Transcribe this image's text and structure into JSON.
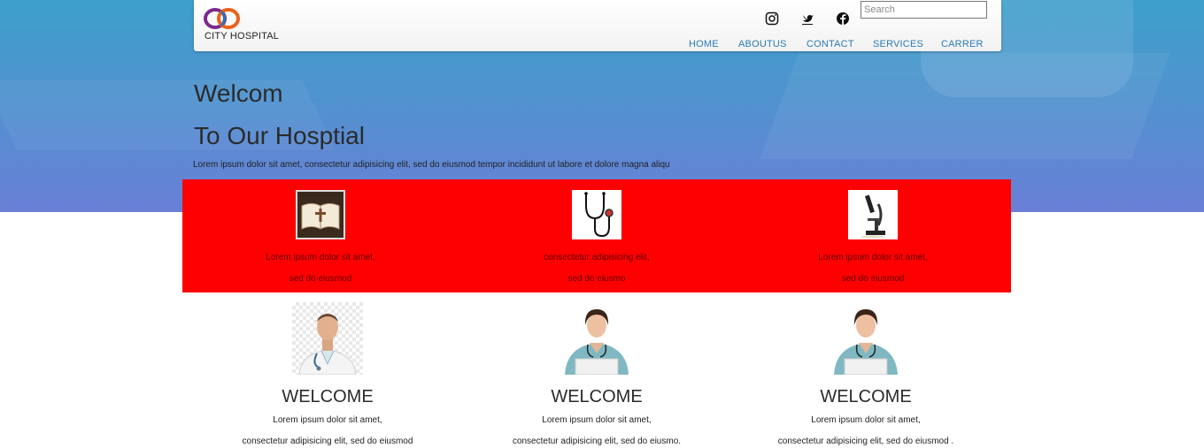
{
  "header": {
    "brand": "CITY HOSPITAL",
    "search": {
      "placeholder": "Search",
      "value": ""
    },
    "social": [
      "instagram-icon",
      "twitter-icon",
      "facebook-icon"
    ],
    "nav": [
      "HOME",
      "ABOUTUS",
      "CONTACT",
      "SERVICES",
      "CARRER"
    ]
  },
  "hero": {
    "title_line1": "Welcom",
    "title_line2": "To Our Hosptial",
    "intro": "Lorem ipsum dolor sit amet, consectetur adipisicing elit, sed do eiusmod tempor incididunt ut labore et dolore magna aliqu"
  },
  "features": [
    {
      "icon": "bible-image",
      "line1": "Lorem ipsum dolor sit amet,",
      "line2": "sed do eiusmod"
    },
    {
      "icon": "stethoscope-image",
      "line1": "consectetur adipisicing elit,",
      "line2": "sed do eiusmo"
    },
    {
      "icon": "microscope-image",
      "line1": "Lorem ipsum dolor sit amet,",
      "line2": "sed do eiusmod"
    }
  ],
  "cards": [
    {
      "image": "male-doctor-photo",
      "title": "WELCOME",
      "line1": "Lorem ipsum dolor sit amet,",
      "line2": "consectetur adipisicing elit, sed do eiusmod"
    },
    {
      "image": "female-nurse-photo",
      "title": "WELCOME",
      "line1": "Lorem ipsum dolor sit amet,",
      "line2": "consectetur adipisicing elit, sed do eiusmo."
    },
    {
      "image": "female-nurse-photo",
      "title": "WELCOME",
      "line1": "Lorem ipsum dolor sit amet,",
      "line2": "consectetur adipisicing elit, sed do eiusmod ."
    }
  ],
  "colors": {
    "band": "#ff0000",
    "nav_link": "#2a7ab5",
    "hero_top": "#3d9fcb",
    "hero_bottom": "#6a7fd6"
  }
}
